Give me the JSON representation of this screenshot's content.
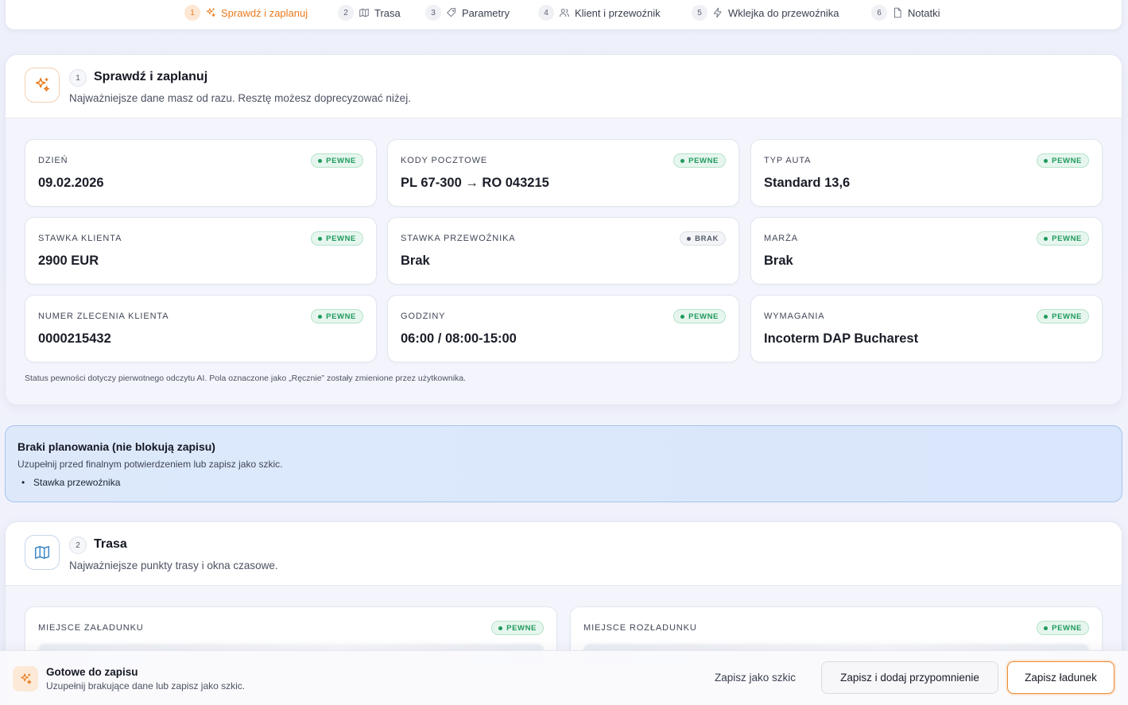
{
  "nav": {
    "steps": [
      {
        "num": "1",
        "label": "Sprawdź i zaplanuj",
        "icon": "sparkles-icon",
        "active": true
      },
      {
        "num": "2",
        "label": "Trasa",
        "icon": "map-icon"
      },
      {
        "num": "3",
        "label": "Parametry",
        "icon": "tag-icon"
      },
      {
        "num": "4",
        "label": "Klient i przewoźnik",
        "icon": "users-icon"
      },
      {
        "num": "5",
        "label": "Wklejka do przewoźnika",
        "icon": "bolt-icon"
      },
      {
        "num": "6",
        "label": "Notatki",
        "icon": "file-icon"
      }
    ]
  },
  "section1": {
    "num": "1",
    "title": "Sprawdź i zaplanuj",
    "subtitle": "Najważniejsze dane masz od razu. Resztę możesz doprecyzować niżej.",
    "icon": "sparkles-icon",
    "fields": [
      {
        "label": "Dzień",
        "value": "09.02.2026",
        "badge": "PEWNE",
        "status": "ok"
      },
      {
        "label": "Kody pocztowe",
        "value": "PL 67-300 → RO 043215",
        "badge": "PEWNE",
        "status": "ok"
      },
      {
        "label": "Typ auta",
        "value": "Standard 13,6",
        "badge": "PEWNE",
        "status": "ok"
      },
      {
        "label": "Stawka klienta",
        "value": "2900 EUR",
        "badge": "PEWNE",
        "status": "ok"
      },
      {
        "label": "Stawka przewoźnika",
        "value": "Brak",
        "badge": "BRAK",
        "status": "miss"
      },
      {
        "label": "Marża",
        "value": "Brak",
        "badge": "PEWNE",
        "status": "ok"
      },
      {
        "label": "Numer zlecenia klienta",
        "value": "0000215432",
        "badge": "PEWNE",
        "status": "ok"
      },
      {
        "label": "Godziny",
        "value": "06:00 / 08:00-15:00",
        "badge": "PEWNE",
        "status": "ok"
      },
      {
        "label": "Wymagania",
        "value": "Incoterm DAP Bucharest",
        "badge": "PEWNE",
        "status": "ok"
      }
    ],
    "note": "Status pewności dotyczy pierwotnego odczytu AI. Pola oznaczone jako „Ręcznie” zostały zmienione przez użytkownika."
  },
  "alert": {
    "title": "Braki planowania (nie blokują zapisu)",
    "subtitle": "Uzupełnij przed finalnym potwierdzeniem lub zapisz jako szkic.",
    "items": [
      "Stawka przewoźnika"
    ]
  },
  "section2": {
    "num": "2",
    "title": "Trasa",
    "subtitle": "Najważniejsze punkty trasy i okna czasowe.",
    "icon": "map-icon",
    "fields": [
      {
        "label": "Miejsce załadunku",
        "badge": "PEWNE",
        "status": "ok"
      },
      {
        "label": "Miejsce rozładunku",
        "badge": "PEWNE",
        "status": "ok"
      }
    ]
  },
  "footer": {
    "title": "Gotowe do zapisu",
    "subtitle": "Uzupełnij brakujące dane lub zapisz jako szkic.",
    "icon": "sparkles-icon",
    "btn_draft": "Zapisz jako szkic",
    "btn_reminder": "Zapisz i dodaj przypomnienie",
    "btn_save": "Zapisz ładunek"
  },
  "colors": {
    "accent": "#ea7a1c",
    "ok": "#1f9a5c",
    "alert_bg": "#dde9fb",
    "alert_border": "#a9c4ee"
  }
}
